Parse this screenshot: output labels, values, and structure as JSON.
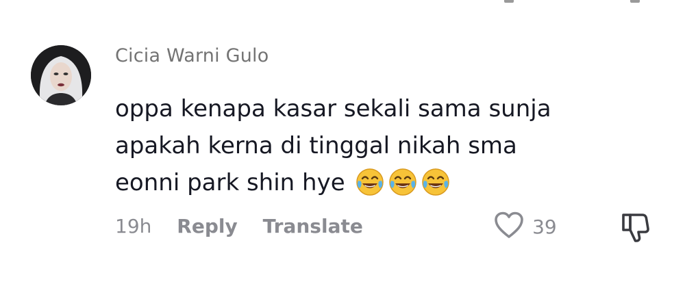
{
  "comment": {
    "username": "Cicia Warni Gulo",
    "text_lines": [
      "oppa kenapa kasar sekali sama sunja",
      "apakah kerna di tinggal nikah sma",
      "eonni park shin hye"
    ],
    "emojis": [
      "face-with-tears-of-joy",
      "face-with-tears-of-joy",
      "face-with-tears-of-joy"
    ],
    "timestamp": "19h",
    "reply_label": "Reply",
    "translate_label": "Translate",
    "like_count": "39",
    "icons": {
      "like": "heart-icon",
      "dislike": "thumbs-down-icon"
    }
  },
  "colors": {
    "text": "#161823",
    "username": "#737373",
    "meta": "#8a8b91",
    "emoji_face": "#f7c338",
    "emoji_tears": "#5ab3e8"
  }
}
